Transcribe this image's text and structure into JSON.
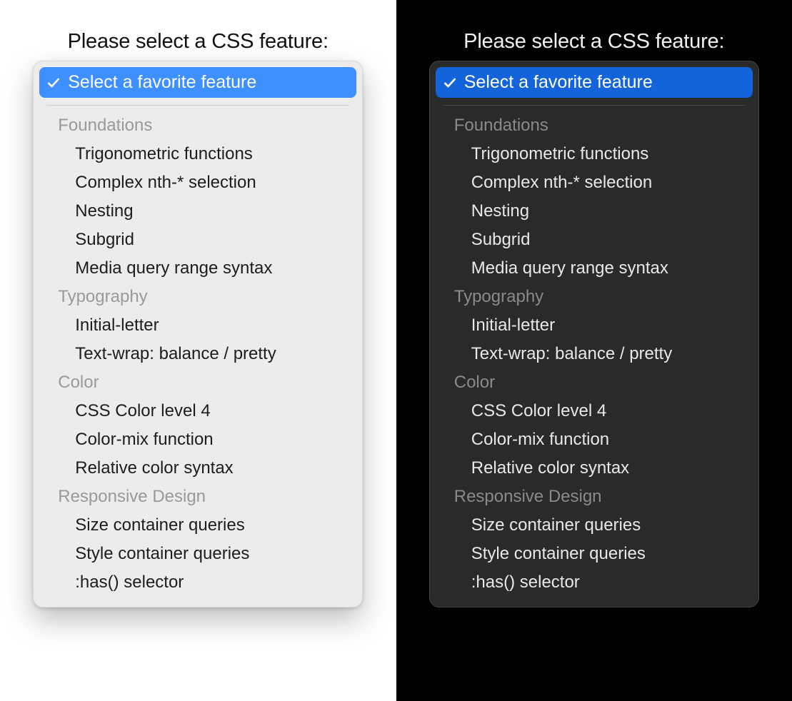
{
  "prompt_label": "Please select a CSS feature:",
  "selected_label": "Select a favorite feature",
  "colors": {
    "light_accent": "#3e8fff",
    "dark_accent": "#1363da"
  },
  "groups": [
    {
      "title": "Foundations",
      "options": [
        "Trigonometric functions",
        "Complex nth-* selection",
        "Nesting",
        "Subgrid",
        "Media query range syntax"
      ]
    },
    {
      "title": "Typography",
      "options": [
        "Initial-letter",
        "Text-wrap: balance / pretty"
      ]
    },
    {
      "title": "Color",
      "options": [
        "CSS Color level 4",
        "Color-mix function",
        "Relative color syntax"
      ]
    },
    {
      "title": "Responsive Design",
      "options": [
        "Size container queries",
        "Style container queries",
        ":has() selector"
      ]
    }
  ]
}
